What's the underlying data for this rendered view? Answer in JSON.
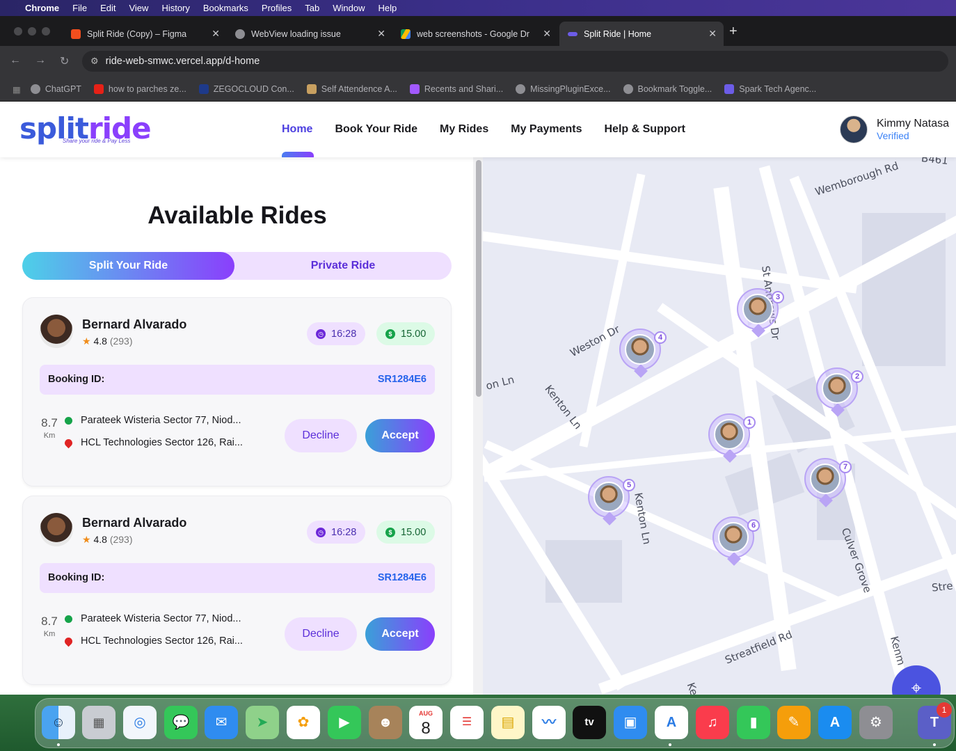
{
  "menubar": {
    "items": [
      "Chrome",
      "File",
      "Edit",
      "View",
      "History",
      "Bookmarks",
      "Profiles",
      "Tab",
      "Window",
      "Help"
    ]
  },
  "tabs": [
    {
      "title": "Split Ride (Copy) – Figma",
      "icon": "figma-icon",
      "color": "#f24e1e"
    },
    {
      "title": "WebView loading issue",
      "icon": "chatgpt-icon",
      "color": "#8e8e93"
    },
    {
      "title": "web screenshots - Google Dr",
      "icon": "google-drive-icon",
      "color": "#fbbc04"
    },
    {
      "title": "Split Ride | Home",
      "icon": "splitride-icon",
      "color": "#6c5ce7"
    }
  ],
  "address": {
    "url": "ride-web-smwc.vercel.app/d-home"
  },
  "bookmarks": [
    {
      "label": "ChatGPT",
      "color": "#8e8e93"
    },
    {
      "label": "how to parches ze...",
      "color": "#e62117"
    },
    {
      "label": "ZEGOCLOUD Con...",
      "color": "#1e3a8a"
    },
    {
      "label": "Self Attendence A...",
      "color": "#c8a060"
    },
    {
      "label": "Recents and Shari...",
      "color": "#a259ff"
    },
    {
      "label": "MissingPluginExce...",
      "color": "#8e8e93"
    },
    {
      "label": "Bookmark Toggle...",
      "color": "#8e8e93"
    },
    {
      "label": "Spark Tech Agenc...",
      "color": "#6c5ce7"
    }
  ],
  "site": {
    "logo_main": "split",
    "logo_accent": "ride",
    "logo_tagline": "Share your ride & Pay Less",
    "nav": [
      "Home",
      "Book Your Ride",
      "My Rides",
      "My Payments",
      "Help & Support"
    ],
    "user_name": "Kimmy Natasa",
    "user_status": "Verified"
  },
  "panel": {
    "title": "Available Rides",
    "tab_split": "Split Your Ride",
    "tab_private": "Private Ride"
  },
  "rides": [
    {
      "driver": "Bernard Alvarado",
      "rating": "4.8",
      "reviews": "(293)",
      "time": "16:28",
      "price": "15.00",
      "booking_label": "Booking ID:",
      "booking_id": "SR1284E6",
      "distance": "8.7",
      "distance_unit": "Km",
      "pickup": "Parateek Wisteria Sector 77, Niod...",
      "dropoff": "HCL Technologies Sector 126, Rai...",
      "decline": "Decline",
      "accept": "Accept"
    },
    {
      "driver": "Bernard Alvarado",
      "rating": "4.8",
      "reviews": "(293)",
      "time": "16:28",
      "price": "15.00",
      "booking_label": "Booking ID:",
      "booking_id": "SR1284E6",
      "distance": "8.7",
      "distance_unit": "Km",
      "pickup": "Parateek Wisteria Sector 77, Niod...",
      "dropoff": "HCL Technologies Sector 126, Rai...",
      "decline": "Decline",
      "accept": "Accept"
    }
  ],
  "map": {
    "labels": [
      "Wemborough Rd",
      "B461",
      "Weston Dr",
      "St Andrews Dr",
      "Kenton Ln",
      "on Ln",
      "Kenton Ln",
      "Culver Grove",
      "Streatfield Rd",
      "Stre",
      "Kenm",
      "Ke"
    ],
    "markers": [
      "1",
      "2",
      "3",
      "4",
      "5",
      "6",
      "7"
    ]
  },
  "dock": {
    "apps": [
      "Finder",
      "Launchpad",
      "Safari",
      "Messages",
      "Mail",
      "Maps",
      "Photos",
      "FaceTime",
      "Contacts",
      "Calendar",
      "Reminders",
      "Notes",
      "Freeform",
      "TV",
      "Keynote",
      "Instruments",
      "Music",
      "Numbers",
      "Pages",
      "App Store",
      "System Settings",
      "Teams"
    ],
    "calendar_month": "AUG",
    "calendar_day": "8",
    "tv_label": "tv",
    "teams_badge": "1"
  }
}
